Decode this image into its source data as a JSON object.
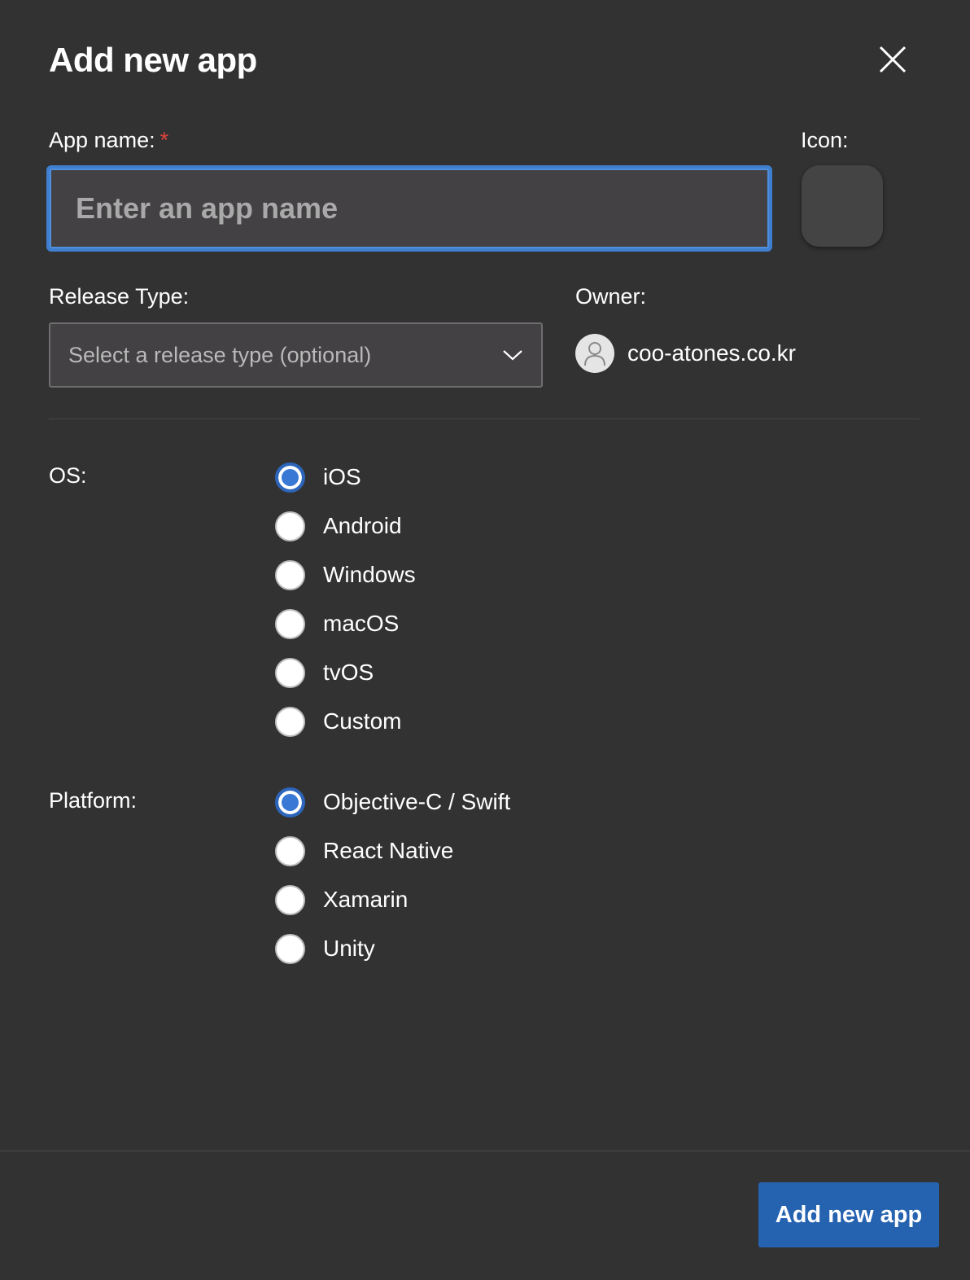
{
  "dialog": {
    "title": "Add new app",
    "close_icon": "close-icon"
  },
  "app_name": {
    "label": "App name:",
    "required_mark": "*",
    "placeholder": "Enter an app name",
    "value": ""
  },
  "icon": {
    "label": "Icon:"
  },
  "release_type": {
    "label": "Release Type:",
    "placeholder": "Select a release type (optional)",
    "icon": "chevron-down-icon"
  },
  "owner": {
    "label": "Owner:",
    "name": "coo-atones.co.kr",
    "avatar_icon": "user-avatar-icon"
  },
  "os": {
    "label": "OS:",
    "selected": "iOS",
    "options": [
      "iOS",
      "Android",
      "Windows",
      "macOS",
      "tvOS",
      "Custom"
    ]
  },
  "platform": {
    "label": "Platform:",
    "selected": "Objective-C / Swift",
    "options": [
      "Objective-C / Swift",
      "React Native",
      "Xamarin",
      "Unity"
    ]
  },
  "footer": {
    "submit_label": "Add new app"
  },
  "colors": {
    "background": "#323232",
    "accent": "#2562b0",
    "focus_border": "#3f7fd0",
    "required": "#e0433b"
  }
}
